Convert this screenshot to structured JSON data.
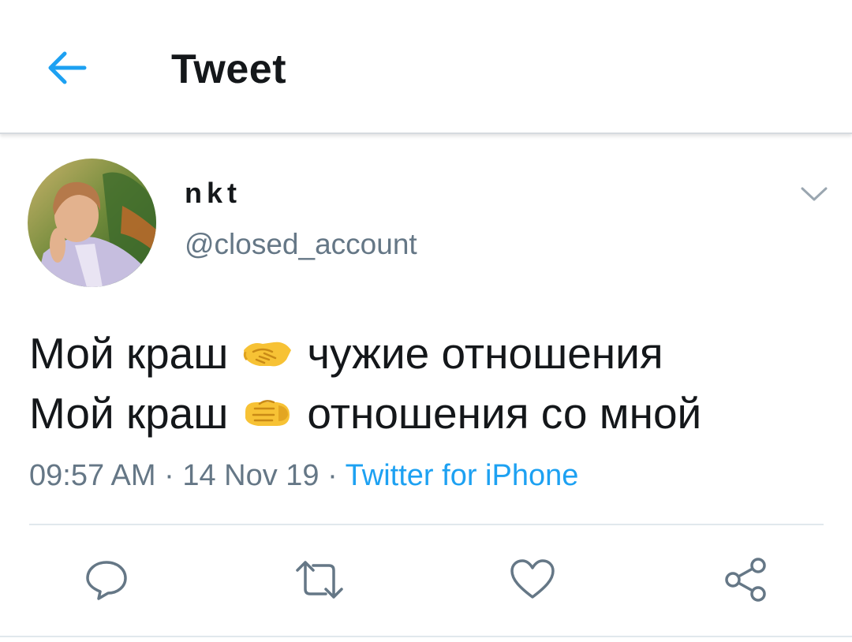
{
  "header": {
    "title": "Tweet",
    "back_icon": "arrow-left-icon"
  },
  "tweet": {
    "author": {
      "display_name": "nkt",
      "handle": "@closed_account",
      "avatar_icon": "user-avatar"
    },
    "more_icon": "chevron-down-icon",
    "lines": [
      {
        "before": "Мой краш",
        "emoji_icon": "handshake-emoji",
        "after": "чужие отношения"
      },
      {
        "before": "Мой краш",
        "emoji_icon": "left-facing-fist-emoji",
        "after": "отношения со мной"
      }
    ],
    "time": "09:57 AM",
    "separator": "·",
    "date": "14 Nov 19",
    "source": "Twitter for iPhone"
  },
  "actions": [
    {
      "name": "reply",
      "icon": "reply-icon"
    },
    {
      "name": "retweet",
      "icon": "retweet-icon"
    },
    {
      "name": "like",
      "icon": "heart-icon"
    },
    {
      "name": "share",
      "icon": "share-icon"
    }
  ],
  "colors": {
    "accent": "#1da1f2",
    "text_primary": "#14171a",
    "text_secondary": "#657786",
    "icon_gray": "#657786",
    "divider": "#e1e8ed"
  }
}
